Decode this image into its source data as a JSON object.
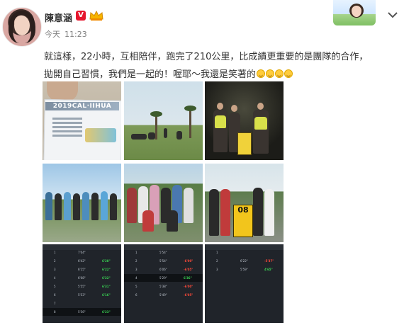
{
  "post": {
    "author": {
      "name": "陳意涵",
      "verified_badge": "V",
      "crown_badge": "crown-icon",
      "avatar": "avatar"
    },
    "meta": {
      "date_label": "今天",
      "time": "11:23"
    },
    "text": {
      "line1": "就這樣，22小時，互相陪伴，跑完了210公里，比成績更重要的是團隊的合作，",
      "line2": "拋開自己習慣，我們是一起的！喔耶～我還是笑著的",
      "emoji_icon": "smile-emoji-icon",
      "emoji_count": 4
    },
    "menu_icon": "chevron-down-icon",
    "header_decoration": "user-avatar-cartoon"
  },
  "photos": {
    "p1": {
      "bib_title": "2019CAL·IIHUA"
    },
    "p6": {
      "sign": "08"
    }
  },
  "splits": {
    "s1": [
      {
        "k": "1",
        "pace": "7'04\"",
        "hr": ""
      },
      {
        "k": "2",
        "pace": "6'42\"",
        "hr": "6'28\""
      },
      {
        "k": "3",
        "pace": "6'15\"",
        "hr": "6'22\""
      },
      {
        "k": "4",
        "pace": "6'08\"",
        "hr": "6'22\""
      },
      {
        "k": "5",
        "pace": "5'55\"",
        "hr": "6'31\""
      },
      {
        "k": "6",
        "pace": "5'53\"",
        "hr": "6'16\""
      },
      {
        "k": "7",
        "pace": "",
        "hr": ""
      },
      {
        "k": "8",
        "pace": "5'56\"",
        "hr": "6'23\""
      }
    ],
    "s2": [
      {
        "k": "1",
        "pace": "5'54\"",
        "hr": ""
      },
      {
        "k": "2",
        "pace": "5'54\"",
        "hr": "-6'00\""
      },
      {
        "k": "3",
        "pace": "6'06\"",
        "hr": "-6'05\""
      },
      {
        "k": "4",
        "pace": "5'29\"",
        "hr": "6'36\""
      },
      {
        "k": "5",
        "pace": "5'38\"",
        "hr": "-6'00\""
      },
      {
        "k": "6",
        "pace": "5'49\"",
        "hr": "-6'05\""
      }
    ],
    "s3": [
      {
        "k": "1",
        "pace": "",
        "hr": ""
      },
      {
        "k": "2",
        "pace": "6'22\"",
        "hr": "-5'37\""
      },
      {
        "k": "3",
        "pace": "5'59\"",
        "hr": "4'65\""
      }
    ],
    "colors": {
      "good": "#39d353",
      "bad": "#ff4a3a",
      "bg": "#20242a"
    }
  },
  "colors": {
    "text": "#333333",
    "muted": "#808080",
    "vip": "#e6162d",
    "page": "#ffffff"
  }
}
